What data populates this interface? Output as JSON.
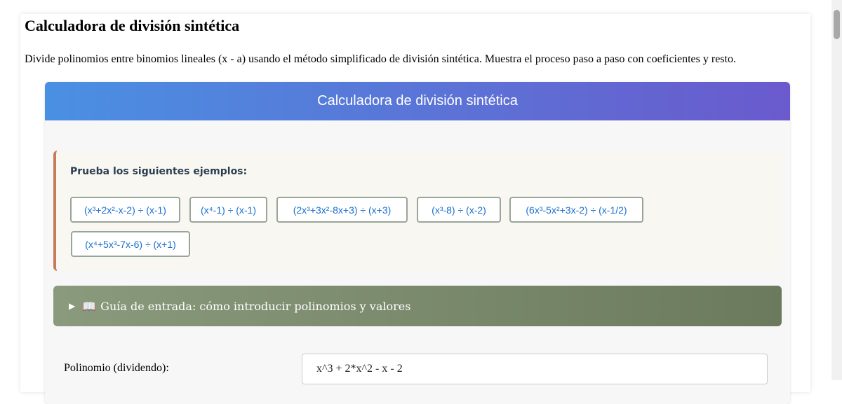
{
  "page": {
    "title": "Calculadora de división sintética",
    "description": "Divide polinomios entre binomios lineales (x - a) usando el método simplificado de división sintética. Muestra el proceso paso a paso con coeficientes y resto."
  },
  "calculator": {
    "header": "Calculadora de división sintética",
    "examples": {
      "title": "Prueba los siguientes ejemplos:",
      "items": [
        "(x³+2x²-x-2) ÷ (x-1)",
        "(x⁴-1) ÷ (x-1)",
        "(2x³+3x²-8x+3) ÷ (x+3)",
        "(x³-8) ÷ (x-2)",
        "(6x³-5x²+3x-2) ÷ (x-1/2)",
        "(x⁴+5x³-7x-6) ÷ (x+1)"
      ]
    },
    "guide": {
      "arrow": "▶",
      "icon": "📖",
      "label": "Guía de entrada: cómo introducir polinomios y valores"
    },
    "dividend": {
      "label": "Polinomio (dividendo):",
      "value": "x^3 + 2*x^2 - x - 2"
    }
  },
  "colors": {
    "header_gradient_start": "#4a90e2",
    "header_gradient_end": "#6a5acd",
    "example_accent": "#c97a5a",
    "example_text": "#1a6fd1",
    "guide_bg": "#7a8a6c"
  }
}
